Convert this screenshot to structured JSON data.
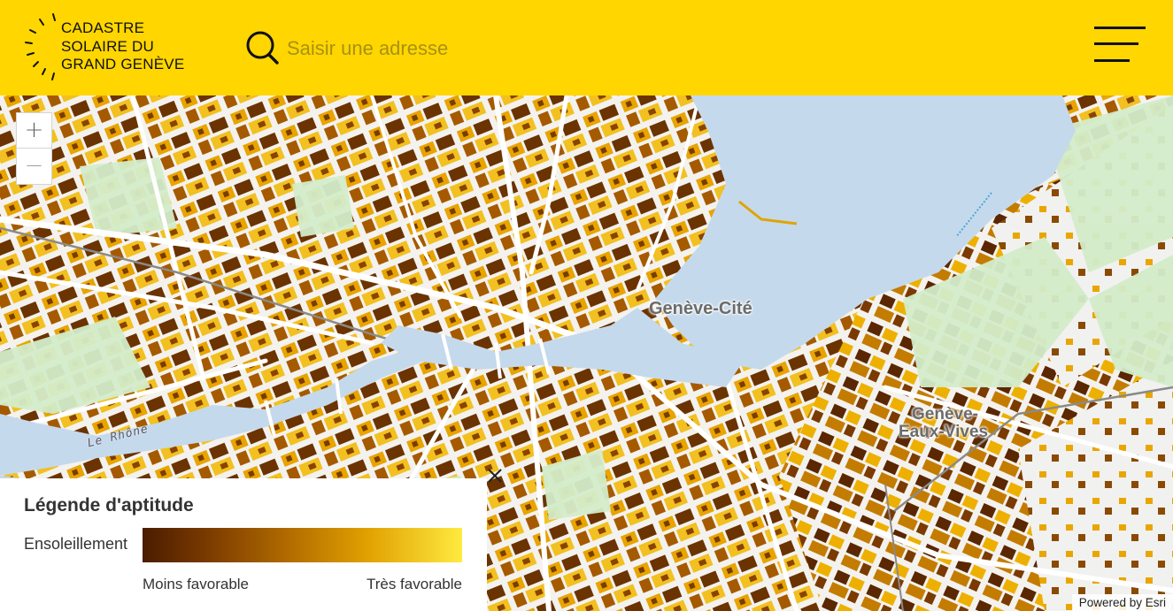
{
  "header": {
    "logo_lines": [
      "CADASTRE",
      "SOLAIRE DU",
      "GRAND GENÈVE"
    ],
    "search_placeholder": "Saisir une adresse",
    "search_value": "",
    "colors": {
      "background": "#ffd600"
    }
  },
  "map": {
    "place_labels": [
      "Genève-Cité",
      "Genève-",
      "Eaux-Vives"
    ],
    "river_label": "Le Rhône",
    "zoom_in_label": "+",
    "zoom_out_label": "—",
    "attribution": "Powered by Esri",
    "colors": {
      "water": "#c5d9ec",
      "park": "#d3ecc9",
      "road": "#ffffff",
      "building_dark": "#5a2a00",
      "building_light": "#f0b000"
    }
  },
  "legend": {
    "title": "Légende d'aptitude",
    "row_label": "Ensoleillement",
    "min_label": "Moins favorable",
    "max_label": "Très favorable",
    "close_icon": "close-icon",
    "colors": {
      "gradient_start": "#4a1c00",
      "gradient_end": "#ffea40"
    }
  }
}
